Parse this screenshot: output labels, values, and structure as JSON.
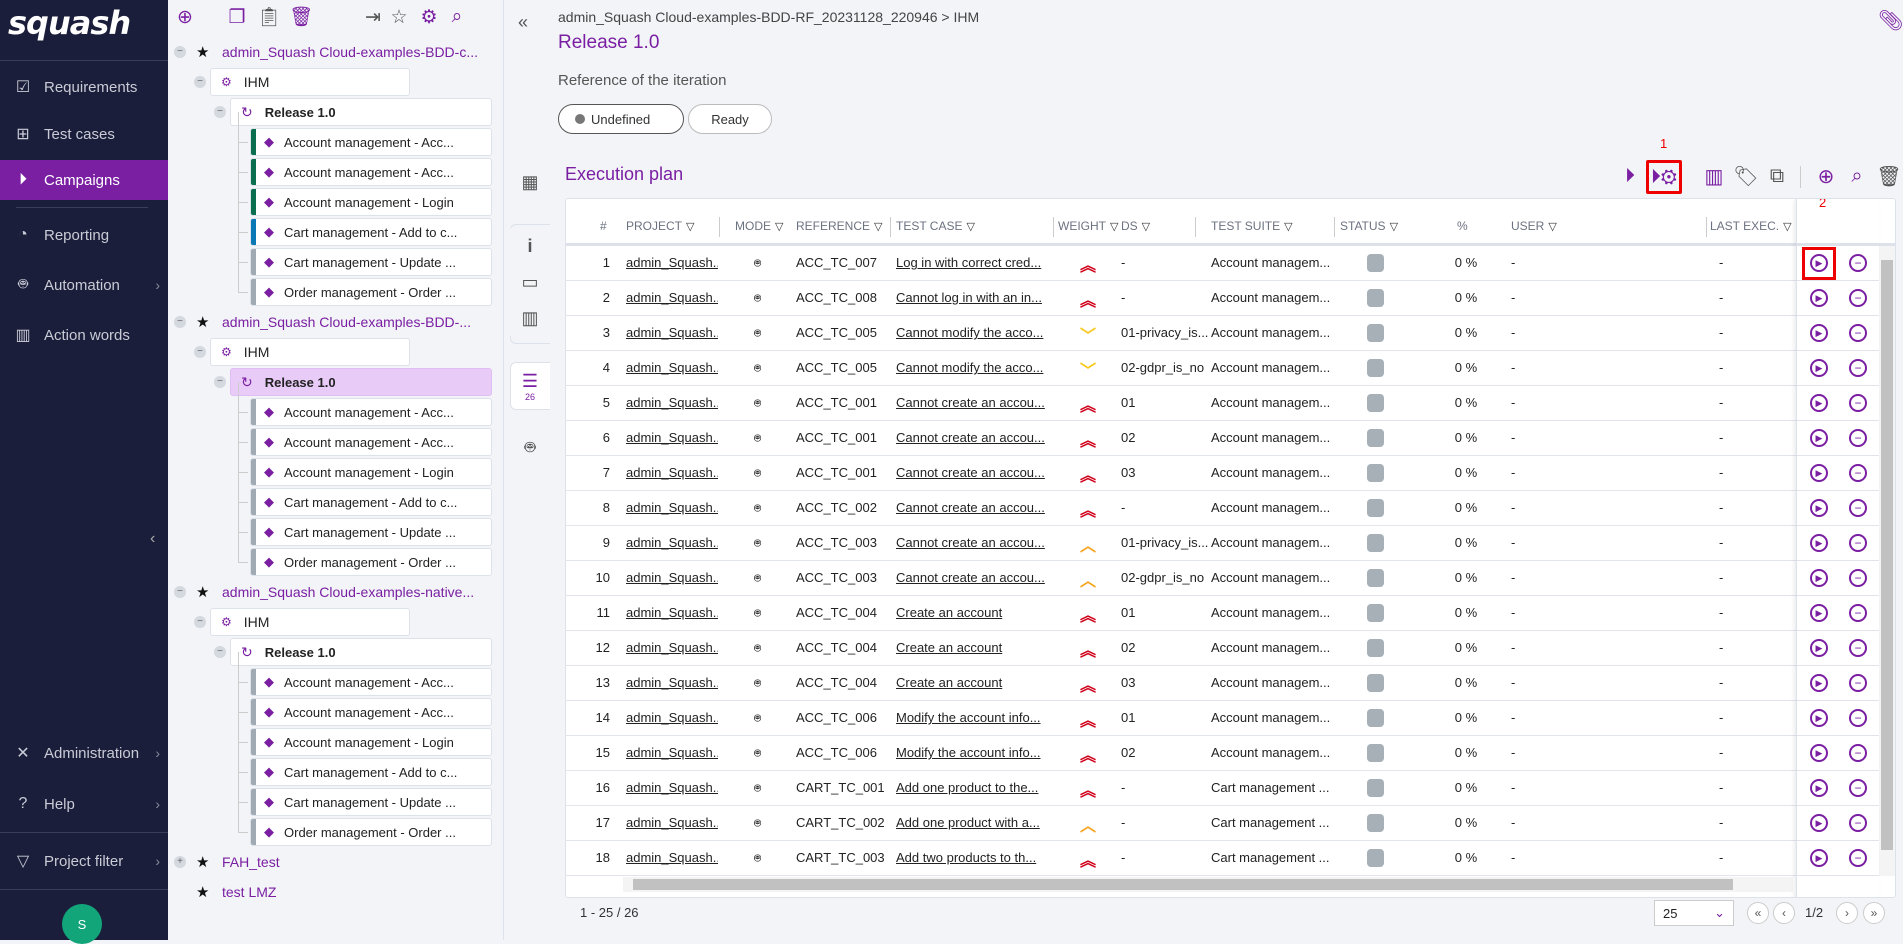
{
  "colors": {
    "accent": "#7a1fa2",
    "nav_bg": "#1b1e3a",
    "weight_very_high": "#d0021b",
    "weight_medium": "#f5a623",
    "weight_low": "#f8c81c",
    "status_ready": "#a7b0b6"
  },
  "nav": {
    "logo": "squash",
    "items": [
      {
        "label": "Requirements",
        "icon": "checkbox-icon"
      },
      {
        "label": "Test cases",
        "icon": "tree-icon"
      },
      {
        "label": "Campaigns",
        "icon": "play-circle-icon",
        "active": true
      },
      {
        "label": "Reporting",
        "icon": "pie-icon"
      },
      {
        "label": "Automation",
        "icon": "robot-icon",
        "chevron": true
      },
      {
        "label": "Action words",
        "icon": "library-icon"
      }
    ],
    "bottom": [
      {
        "label": "Administration",
        "icon": "tools-icon"
      },
      {
        "label": "Help",
        "icon": "help-icon"
      },
      {
        "label": "Project filter",
        "icon": "filter-icon"
      }
    ],
    "avatar": "S"
  },
  "tree": {
    "projects": [
      {
        "name": "admin_Squash Cloud-examples-BDD-c...",
        "folder": "IHM",
        "iteration": "Release 1.0",
        "selected": false,
        "suites": [
          "Account management - Acc...",
          "Account management - Acc...",
          "Account management - Login",
          "Cart management - Add to c...",
          "Cart management - Update ...",
          "Order management - Order ..."
        ],
        "bars": [
          "#0b6e4f",
          "#0b6e4f",
          "#0b6e4f",
          "#0a78b4",
          "#a0aab3",
          "#a0aab3"
        ]
      },
      {
        "name": "admin_Squash Cloud-examples-BDD-...",
        "folder": "IHM",
        "iteration": "Release 1.0",
        "selected": true,
        "suites": [
          "Account management - Acc...",
          "Account management - Acc...",
          "Account management - Login",
          "Cart management - Add to c...",
          "Cart management - Update ...",
          "Order management - Order ..."
        ],
        "bars": [
          "#a0aab3",
          "#a0aab3",
          "#a0aab3",
          "#a0aab3",
          "#a0aab3",
          "#a0aab3"
        ]
      },
      {
        "name": "admin_Squash Cloud-examples-native...",
        "folder": "IHM",
        "iteration": "Release 1.0",
        "selected": false,
        "suites": [
          "Account management - Acc...",
          "Account management - Acc...",
          "Account management - Login",
          "Cart management - Add to c...",
          "Cart management - Update ...",
          "Order management - Order ..."
        ],
        "bars": [
          "#a0aab3",
          "#a0aab3",
          "#a0aab3",
          "#a0aab3",
          "#a0aab3",
          "#a0aab3"
        ]
      }
    ],
    "others": [
      "FAH_test",
      "test LMZ"
    ]
  },
  "strip": {
    "plan_count": "26"
  },
  "header": {
    "breadcrumb": "admin_Squash Cloud-examples-BDD-RF_20231128_220946 > IHM",
    "title": "Release 1.0",
    "reference_label": "Reference of the iteration",
    "status_options": [
      "Undefined",
      "Ready"
    ],
    "selected_status": "Undefined"
  },
  "plan": {
    "title": "Execution plan",
    "annotation_1": "1",
    "annotation_2": "2",
    "columns": [
      "#",
      "PROJECT",
      "MODE",
      "REFERENCE",
      "TEST CASE",
      "WEIGHT",
      "DS",
      "TEST SUITE",
      "STATUS",
      "%",
      "USER",
      "LAST EXEC."
    ],
    "rows": [
      [
        "1",
        "admin_Squash...",
        "ACC_TC_007",
        "Log in with correct cred...",
        "very_high",
        "-",
        "Account managem...",
        "0 %",
        "-",
        "-"
      ],
      [
        "2",
        "admin_Squash...",
        "ACC_TC_008",
        "Cannot log in with an in...",
        "very_high",
        "-",
        "Account managem...",
        "0 %",
        "-",
        "-"
      ],
      [
        "3",
        "admin_Squash...",
        "ACC_TC_005",
        "Cannot modify the acco...",
        "low",
        "01-privacy_is...",
        "Account managem...",
        "0 %",
        "-",
        "-"
      ],
      [
        "4",
        "admin_Squash...",
        "ACC_TC_005",
        "Cannot modify the acco...",
        "low",
        "02-gdpr_is_no",
        "Account managem...",
        "0 %",
        "-",
        "-"
      ],
      [
        "5",
        "admin_Squash...",
        "ACC_TC_001",
        "Cannot create an accou...",
        "very_high",
        "01",
        "Account managem...",
        "0 %",
        "-",
        "-"
      ],
      [
        "6",
        "admin_Squash...",
        "ACC_TC_001",
        "Cannot create an accou...",
        "very_high",
        "02",
        "Account managem...",
        "0 %",
        "-",
        "-"
      ],
      [
        "7",
        "admin_Squash...",
        "ACC_TC_001",
        "Cannot create an accou...",
        "very_high",
        "03",
        "Account managem...",
        "0 %",
        "-",
        "-"
      ],
      [
        "8",
        "admin_Squash...",
        "ACC_TC_002",
        "Cannot create an accou...",
        "very_high",
        "-",
        "Account managem...",
        "0 %",
        "-",
        "-"
      ],
      [
        "9",
        "admin_Squash...",
        "ACC_TC_003",
        "Cannot create an accou...",
        "medium",
        "01-privacy_is...",
        "Account managem...",
        "0 %",
        "-",
        "-"
      ],
      [
        "10",
        "admin_Squash...",
        "ACC_TC_003",
        "Cannot create an accou...",
        "medium",
        "02-gdpr_is_no",
        "Account managem...",
        "0 %",
        "-",
        "-"
      ],
      [
        "11",
        "admin_Squash...",
        "ACC_TC_004",
        "Create an account",
        "very_high",
        "01",
        "Account managem...",
        "0 %",
        "-",
        "-"
      ],
      [
        "12",
        "admin_Squash...",
        "ACC_TC_004",
        "Create an account",
        "very_high",
        "02",
        "Account managem...",
        "0 %",
        "-",
        "-"
      ],
      [
        "13",
        "admin_Squash...",
        "ACC_TC_004",
        "Create an account",
        "very_high",
        "03",
        "Account managem...",
        "0 %",
        "-",
        "-"
      ],
      [
        "14",
        "admin_Squash...",
        "ACC_TC_006",
        "Modify the account info...",
        "very_high",
        "01",
        "Account managem...",
        "0 %",
        "-",
        "-"
      ],
      [
        "15",
        "admin_Squash...",
        "ACC_TC_006",
        "Modify the account info...",
        "very_high",
        "02",
        "Account managem...",
        "0 %",
        "-",
        "-"
      ],
      [
        "16",
        "admin_Squash...",
        "CART_TC_001",
        "Add one product to the...",
        "very_high",
        "-",
        "Cart management ...",
        "0 %",
        "-",
        "-"
      ],
      [
        "17",
        "admin_Squash...",
        "CART_TC_002",
        "Add one product with a...",
        "medium",
        "-",
        "Cart management ...",
        "0 %",
        "-",
        "-"
      ],
      [
        "18",
        "admin_Squash...",
        "CART_TC_003",
        "Add two products to th...",
        "very_high",
        "-",
        "Cart management ...",
        "0 %",
        "-",
        "-"
      ]
    ],
    "pagination": {
      "range": "1 - 25 / 26",
      "page_size": "25",
      "page": "1/2"
    }
  }
}
